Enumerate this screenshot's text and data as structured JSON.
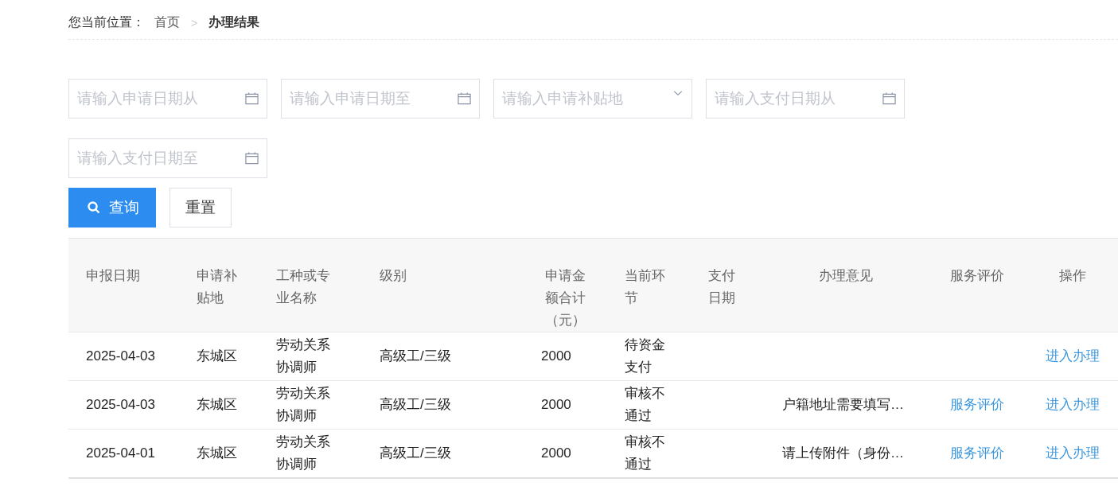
{
  "breadcrumb": {
    "label": "您当前位置：",
    "separator": ">",
    "items": [
      {
        "text": "首页",
        "current": false
      },
      {
        "text": "办理结果",
        "current": true
      }
    ]
  },
  "filters": [
    {
      "kind": "date",
      "placeholder": "请输入申请日期从"
    },
    {
      "kind": "date",
      "placeholder": "请输入申请日期至"
    },
    {
      "kind": "select",
      "placeholder": "请输入申请补贴地"
    },
    {
      "kind": "date",
      "placeholder": "请输入支付日期从"
    },
    {
      "kind": "date",
      "placeholder": "请输入支付日期至"
    }
  ],
  "buttons": [
    {
      "kind": "primary",
      "label": "查询"
    },
    {
      "kind": "plain",
      "label": "重置"
    }
  ],
  "table": {
    "columns": [
      {
        "label": "申报日期"
      },
      {
        "label": "申请补贴地"
      },
      {
        "label": "工种或专业名称"
      },
      {
        "label": "级别"
      },
      {
        "label": "申请金额合计（元）"
      },
      {
        "label": "当前环节"
      },
      {
        "label": "支付日期"
      },
      {
        "label": "办理意见"
      },
      {
        "label": "服务评价"
      },
      {
        "label": "操作"
      }
    ],
    "rows": [
      {
        "cells": [
          "2025-04-03",
          "东城区",
          "劳动关系协调师",
          "高级工/三级",
          "2000",
          "待资金支付",
          "",
          ""
        ],
        "evaluation": "",
        "action": "进入办理"
      },
      {
        "cells": [
          "2025-04-03",
          "东城区",
          "劳动关系协调师",
          "高级工/三级",
          "2000",
          "审核不通过",
          "",
          "户籍地址需要填写…"
        ],
        "evaluation": "服务评价",
        "action": "进入办理"
      },
      {
        "cells": [
          "2025-04-01",
          "东城区",
          "劳动关系协调师",
          "高级工/三级",
          "2000",
          "审核不通过",
          "",
          "请上传附件（身份…"
        ],
        "evaluation": "服务评价",
        "action": "进入办理"
      }
    ]
  }
}
